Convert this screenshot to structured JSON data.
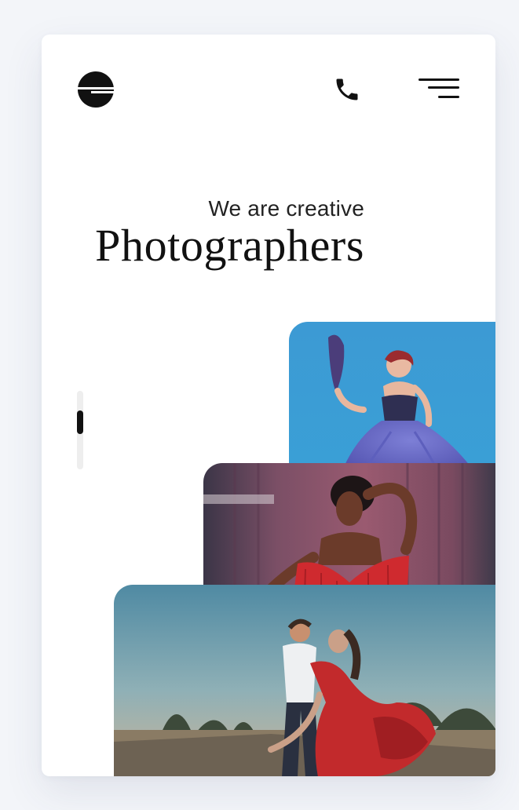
{
  "header": {
    "logo_icon": "circle-stripe-logo-icon",
    "phone_icon": "phone-icon",
    "menu_icon": "hamburger-menu-icon"
  },
  "hero": {
    "subtitle": "We are creative",
    "title": "Photographers"
  },
  "scroll_indicator": {
    "position_fraction": 0.35
  },
  "gallery": [
    {
      "description_icon": "photo-woman-blue-gown",
      "accent": "#3d9bd2"
    },
    {
      "description_icon": "photo-woman-red-dress",
      "accent": "#c8283a"
    },
    {
      "description_icon": "photo-dancing-couple",
      "accent": "#6a8fa0"
    }
  ],
  "colors": {
    "background": "#f3f5f9",
    "card": "#ffffff",
    "text": "#111111"
  }
}
